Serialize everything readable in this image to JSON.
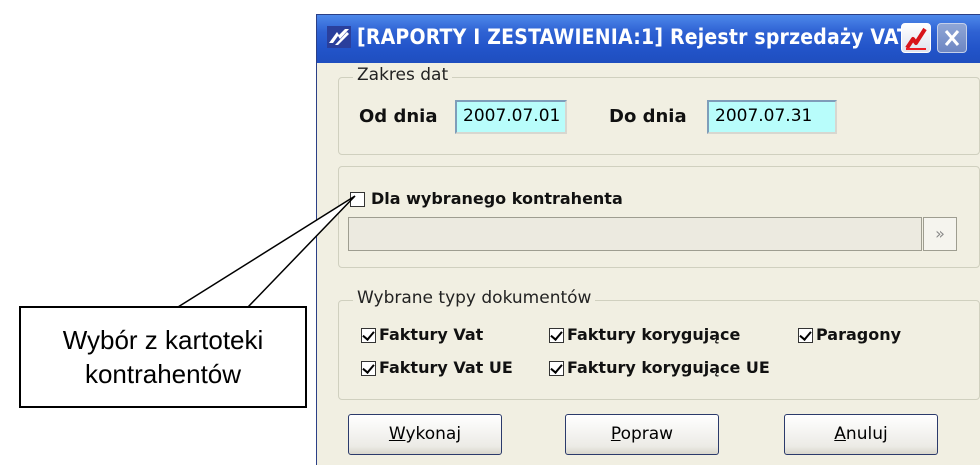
{
  "window": {
    "title": "[RAPORTY I ZESTAWIENIA:1]  Rejestr sprzedaży VAT",
    "accent_color": "#2254c9",
    "date_field_color": "#b8fdfb",
    "icons": {
      "app": "app-logo-icon",
      "chart": "chart-icon",
      "close": "close-icon"
    }
  },
  "date_range": {
    "caption": "Zakres dat",
    "from_label": "Od dnia",
    "from_value": "2007.07.01",
    "to_label": "Do dnia",
    "to_value": "2007.07.31"
  },
  "contractor": {
    "checkbox_label": "Dla wybranego kontrahenta",
    "checked": false,
    "field_value": "",
    "browse_button": "»"
  },
  "document_types": {
    "caption": "Wybrane typy dokumentów",
    "items": [
      {
        "label": "Faktury Vat",
        "checked": true
      },
      {
        "label": "Faktury korygujące",
        "checked": true
      },
      {
        "label": "Paragony",
        "checked": true
      },
      {
        "label": "Faktury Vat UE",
        "checked": true
      },
      {
        "label": "Faktury korygujące UE",
        "checked": true
      }
    ]
  },
  "buttons": {
    "execute": {
      "hotkey": "W",
      "rest": "ykonaj"
    },
    "correct": {
      "hotkey": "P",
      "rest": "opraw"
    },
    "cancel": {
      "hotkey": "A",
      "rest": "nuluj"
    }
  },
  "callout": {
    "line1": "Wybór z kartoteki",
    "line2": "kontrahentów"
  }
}
